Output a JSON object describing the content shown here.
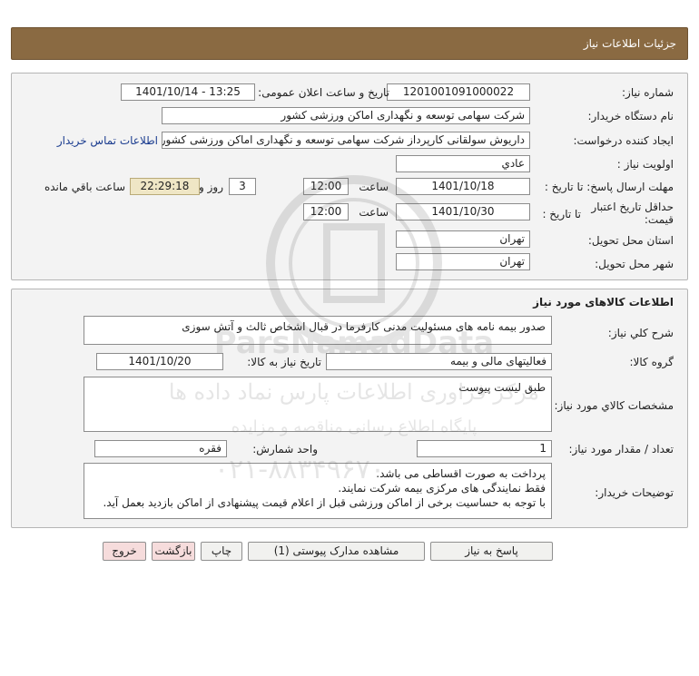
{
  "header": {
    "title": "جزئیات اطلاعات نیاز"
  },
  "details": {
    "need_number_label": "شماره نیاز:",
    "need_number": "1201001091000022",
    "announce_label": "تاریخ و ساعت اعلان عمومی:",
    "announce_value": "1401/10/14 - 13:25",
    "buyer_org_label": "نام دستگاه خریدار:",
    "buyer_org": "شرکت سهامی توسعه و نگهداری اماکن ورزشی کشور",
    "creator_label": "ایجاد کننده درخواست:",
    "creator": "داریوش سولقانی کارپرداز شرکت سهامی توسعه و نگهداری اماکن ورزشی کشور",
    "contact_link": "اطلاعات تماس خریدار",
    "priority_label": "اولویت نیاز :",
    "priority": "عادي",
    "send_deadline_label": "مهلت ارسال پاسخ: تا تاریخ :",
    "send_date": "1401/10/18",
    "time_label": "ساعت",
    "send_time": "12:00",
    "days": "3",
    "days_and_label": "روز و",
    "remaining_time": "22:29:18",
    "remaining_label": "ساعت باقي مانده",
    "validity_label": "حداقل تاریخ اعتبار قیمت:",
    "until_date_label": "تا تاریخ :",
    "validity_date": "1401/10/30",
    "validity_time": "12:00",
    "province_label": "استان محل تحویل:",
    "province": "تهران",
    "city_label": "شهر محل تحویل:",
    "city": "تهران"
  },
  "goods": {
    "section_title": "اطلاعات کالاهای مورد نیاز",
    "summary_label": "شرح کلي نیاز:",
    "summary": "صدور بیمه نامه های مسئولیت مدنی کارفرما در قبال اشخاص ثالث و آتش سوزی",
    "group_label": "گروه کالا:",
    "group": "فعالیتهای مالی و بیمه",
    "need_date_label": "تاریخ نیاز به کالا:",
    "need_date": "1401/10/20",
    "specs_label": "مشخصات کالاي مورد نیاز:",
    "specs": "طبق لیست پیوست",
    "qty_label": "تعداد / مقدار مورد نیاز:",
    "qty": "1",
    "unit_label": "واحد شمارش:",
    "unit": "فقره",
    "desc_label": "توضیحات خریدار:",
    "desc_line1": "پرداخت به صورت اقساطی می باشد.",
    "desc_line2": "فقط نمایندگی های مرکزی بیمه شرکت نمایند.",
    "desc_line3": "با توجه به حساسیت برخی از اماکن ورزشی قبل از اعلام قیمت پیشنهادی از اماکن بازدید بعمل آید."
  },
  "buttons": {
    "reply": "پاسخ به نیاز",
    "view_docs": "مشاهده مدارک پیوستی (1)",
    "print": "چاپ",
    "back": "بازگشت",
    "exit": "خروج"
  },
  "watermark": {
    "line1": "مرکز فراوری اطلاعات پارس نماد داده ها",
    "line2": "پایگاه اطلاع رسانی مناقصه و مزایده",
    "phone": "۰۲۱-۸۸۳۴۹۶۷۰",
    "brand": "ParsNamadData"
  },
  "colors": {
    "header_bg": "#8a6a42",
    "remaining_bg": "#efe6c5",
    "link": "#1a3c8f",
    "exit_bg": "#f6dcdc"
  }
}
